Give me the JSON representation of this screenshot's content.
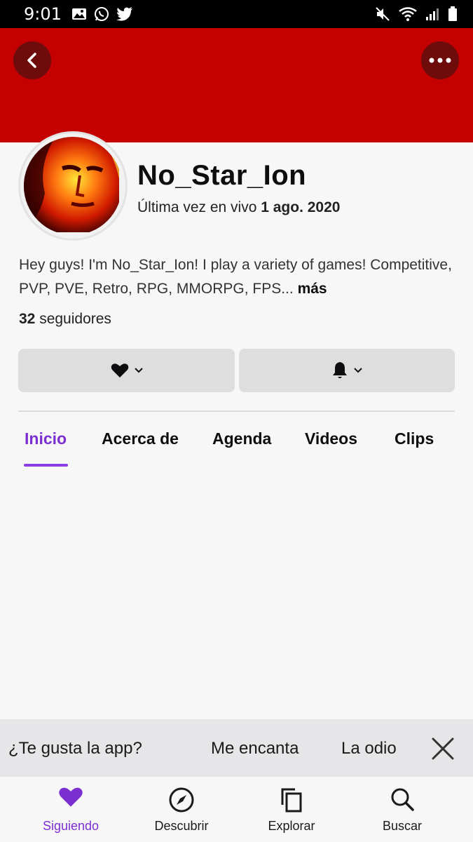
{
  "status_bar": {
    "time": "9:01",
    "left_icons": [
      "image-icon",
      "whatsapp-icon",
      "twitter-icon"
    ],
    "right_icons": [
      "mute-icon",
      "wifi-icon",
      "signal-icon",
      "battery-icon"
    ]
  },
  "banner": {
    "color": "#c40000"
  },
  "profile": {
    "username": "No_Star_Ion",
    "last_live_prefix": "Última vez en vivo",
    "last_live_date": "1 ago. 2020",
    "bio": "Hey guys! I'm No_Star_Ion! I play a variety of games! Competitive, PVP, PVE, Retro, RPG, MMORPG, FPS",
    "bio_ellipsis": "...",
    "bio_more": "más",
    "followers_count": "32",
    "followers_label": "seguidores"
  },
  "tabs": [
    {
      "label": "Inicio",
      "active": true
    },
    {
      "label": "Acerca de",
      "active": false
    },
    {
      "label": "Agenda",
      "active": false
    },
    {
      "label": "Videos",
      "active": false
    },
    {
      "label": "Clips",
      "active": false
    }
  ],
  "rating": {
    "question": "¿Te gusta la app?",
    "love": "Me encanta",
    "hate": "La odio"
  },
  "bottom_nav": [
    {
      "label": "Siguiendo",
      "icon": "heart-icon",
      "active": true
    },
    {
      "label": "Descubrir",
      "icon": "compass-icon",
      "active": false
    },
    {
      "label": "Explorar",
      "icon": "copy-icon",
      "active": false
    },
    {
      "label": "Buscar",
      "icon": "search-icon",
      "active": false
    }
  ],
  "colors": {
    "accent": "#7c2fd1",
    "banner": "#c40000"
  }
}
